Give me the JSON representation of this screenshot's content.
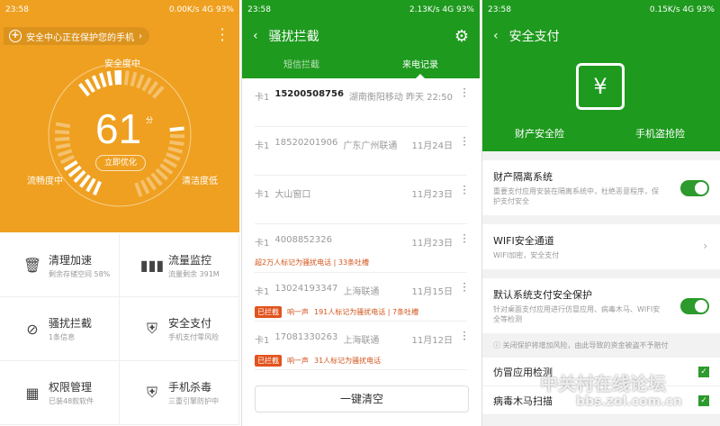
{
  "panel1": {
    "status": {
      "time": "23:58",
      "speed": "0.00K/s",
      "net": "4G",
      "battery": "93%"
    },
    "protect_banner": "安全中心正在保护您的手机",
    "labels": {
      "top": "安全度中",
      "left": "流畅度中",
      "right": "清洁度低"
    },
    "score": "61",
    "score_unit": "分",
    "optimize": "立即优化",
    "tiles": [
      {
        "title": "清理加速",
        "sub": "剩余存储空间 58%"
      },
      {
        "title": "流量监控",
        "sub": "流量剩余 391M"
      },
      {
        "title": "骚扰拦截",
        "sub": "1条信息"
      },
      {
        "title": "安全支付",
        "sub": "手机支付零风险"
      },
      {
        "title": "权限管理",
        "sub": "已装48款软件"
      },
      {
        "title": "手机杀毒",
        "sub": "三重引擎防护中"
      }
    ]
  },
  "panel2": {
    "status": {
      "time": "23:58",
      "speed": "2.13K/s",
      "net": "4G",
      "battery": "93%"
    },
    "title": "骚扰拦截",
    "tabs": [
      "短信拦截",
      "来电记录"
    ],
    "rows": [
      {
        "sim": "卡1",
        "num": "15200508756",
        "loc": "湖南衡阳移动",
        "date": "昨天 22:50"
      },
      {
        "sim": "卡1",
        "num": "18520201906",
        "loc": "广东广州联通",
        "date": "11月24日"
      },
      {
        "sim": "卡1",
        "num": "大山窗口",
        "loc": "",
        "date": "11月23日"
      },
      {
        "sim": "卡1",
        "num": "4008852326",
        "loc": "",
        "date": "11月23日",
        "note": "超2万人标记为骚扰电话 | 33条吐槽"
      },
      {
        "sim": "卡1",
        "num": "13024193347",
        "loc": "上海联通",
        "date": "11月15日",
        "badge": "已拦截",
        "ring": "响一声",
        "note": "191人标记为骚扰电话 | 7条吐槽"
      },
      {
        "sim": "卡1",
        "num": "17081330263",
        "loc": "上海联通",
        "date": "11月12日",
        "badge": "已拦截",
        "ring": "响一声",
        "note": "31人标记为骚扰电话"
      }
    ],
    "clear": "一键清空"
  },
  "panel3": {
    "status": {
      "time": "23:58",
      "speed": "0.15K/s",
      "net": "4G",
      "battery": "93%"
    },
    "title": "安全支付",
    "insurance": [
      "财产安全险",
      "手机盗抢险"
    ],
    "settings": [
      {
        "title": "财产隔离系统",
        "sub": "重要支付应用安装在隔离系统中，杜绝恶意程序，保护支付安全",
        "on": true
      },
      {
        "title": "WIFI安全通道",
        "sub": "WIFI加密，安全支付"
      },
      {
        "title": "默认系统支付安全保护",
        "sub": "针对桌面支付应用进行仿冒应用、病毒木马、WIFI安全等检测",
        "on": true
      }
    ],
    "warning": "关闭保护将增加风险，由此导致的资金被盗不予赔付",
    "checks": [
      "仿冒应用检测",
      "病毒木马扫描"
    ]
  },
  "watermark": [
    "中关村在线论坛",
    "bbs.zol.com.cn"
  ]
}
